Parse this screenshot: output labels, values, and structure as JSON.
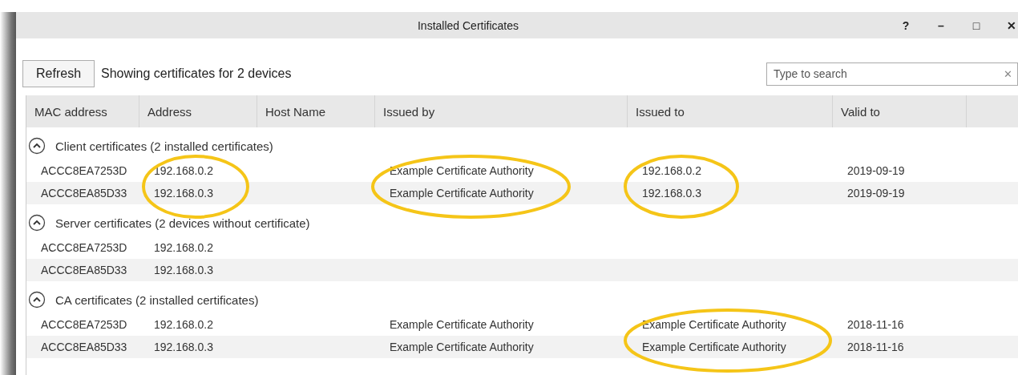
{
  "window": {
    "title": "Installed Certificates",
    "controls": [
      "?",
      "–",
      "□",
      "✕"
    ]
  },
  "toolbar": {
    "refresh": "Refresh",
    "status": "Showing certificates for 2 devices",
    "search": {
      "placeholder": "Type to search",
      "clear": "✕"
    }
  },
  "table": {
    "columns": [
      "MAC address",
      "Address",
      "Host Name",
      "Issued by",
      "Issued to",
      "Valid to"
    ],
    "groups": [
      {
        "title": "Client certificates (2 installed certificates)",
        "expanded": true,
        "highlight_address": true,
        "highlight_issued_by": true,
        "highlight_issued_to": true,
        "rows": [
          {
            "mac": "ACCC8EA7253D",
            "address": "192.168.0.2",
            "issued_by": "Example Certificate Authority",
            "issued_to": "192.168.0.2",
            "valid_to": "2019-09-19"
          },
          {
            "mac": "ACCC8EA85D33",
            "address": "192.168.0.3",
            "issued_by": "Example Certificate Authority",
            "issued_to": "192.168.0.3",
            "valid_to": "2019-09-19"
          }
        ]
      },
      {
        "title": "Server certificates (2 devices without certificate)",
        "expanded": true,
        "highlight_address": false,
        "highlight_issued_by": false,
        "highlight_issued_to": false,
        "rows": [
          {
            "mac": "ACCC8EA7253D",
            "address": "192.168.0.2"
          },
          {
            "mac": "ACCC8EA85D33",
            "address": "192.168.0.3"
          }
        ]
      },
      {
        "title": "CA certificates (2 installed certificates)",
        "expanded": true,
        "highlight_address": false,
        "highlight_issued_by": false,
        "highlight_issued_to": true,
        "rows": [
          {
            "mac": "ACCC8EA7253D",
            "address": "192.168.0.2",
            "issued_by": "Example Certificate Authority",
            "issued_to": "Example Certificate Authority",
            "valid_to": "2018-11-16"
          },
          {
            "mac": "ACCC8EA85D33",
            "address": "192.168.0.3",
            "issued_by": "Example Certificate Authority",
            "issued_to": "Example Certificate Authority",
            "valid_to": "2018-11-16"
          }
        ]
      }
    ]
  }
}
